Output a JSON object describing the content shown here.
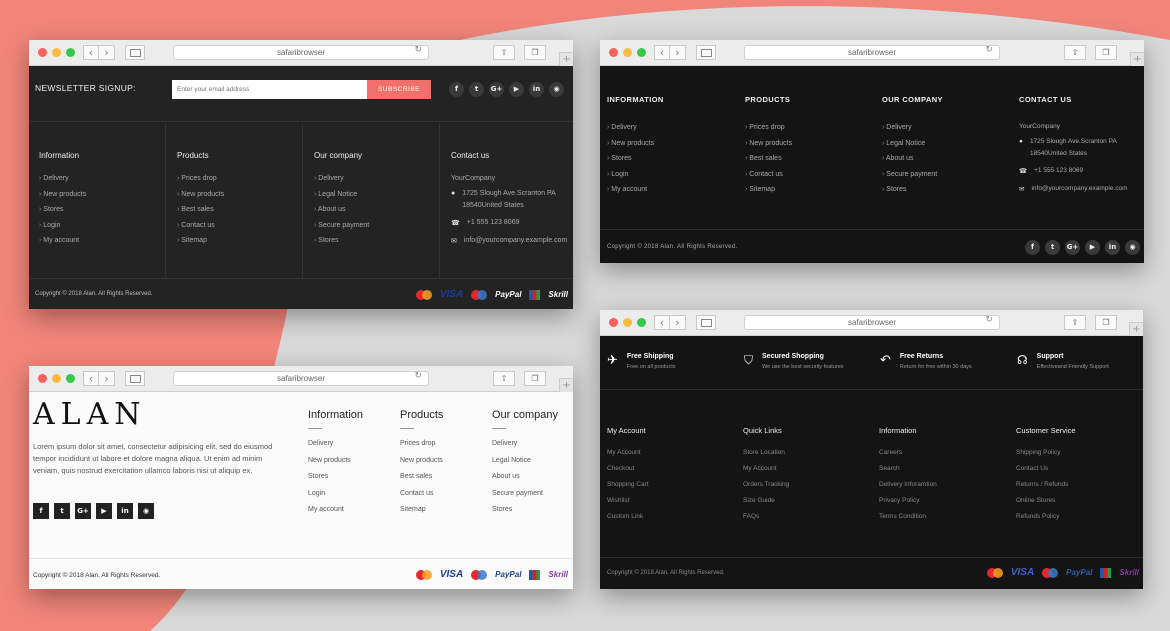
{
  "browser": {
    "url_text": "safaribrowser",
    "back": "‹",
    "forward": "›",
    "reload": "↻",
    "share": "⇧",
    "tabs": "❐",
    "new_tab": "+"
  },
  "colors": {
    "accent": "#f2706b",
    "background_shape": "#f2857a",
    "dark": "#232323",
    "darker": "#141414"
  },
  "w1": {
    "newsletter_label": "NEWSLETTER SIGNUP:",
    "email_placeholder": "Enter your email address",
    "subscribe": "SUBSCRIBE",
    "social": [
      "f",
      "t",
      "G+",
      "▶",
      "in",
      "◉"
    ],
    "cols": [
      {
        "title": "Information",
        "items": [
          "Delivery",
          "New products",
          "Stores",
          "Login",
          "My account"
        ]
      },
      {
        "title": "Products",
        "items": [
          "Prices drop",
          "New products",
          "Best sales",
          "Contact us",
          "Sitemap"
        ]
      },
      {
        "title": "Our company",
        "items": [
          "Delivery",
          "Legal Notice",
          "About us",
          "Secure payment",
          "Stores"
        ]
      }
    ],
    "contact": {
      "title": "Contact us",
      "company": "YourCompany",
      "address1": "1725 Slough Ave.Scranton PA",
      "address2": "18540United States",
      "phone": "+1 555 123 8069",
      "email": "info@yourcompany.example.com"
    },
    "copyright": "Copyright © 2018 Alan. All Rights Reserved.",
    "payments": {
      "visa": "VISA",
      "paypal": "PayPal",
      "skrill": "Skrill"
    }
  },
  "w2": {
    "cols": [
      {
        "title": "INFORMATION",
        "items": [
          "Delivery",
          "New products",
          "Stores",
          "Login",
          "My account"
        ]
      },
      {
        "title": "PRODUCTS",
        "items": [
          "Prices drop",
          "New products",
          "Best sales",
          "Contact us",
          "Sitemap"
        ]
      },
      {
        "title": "OUR COMPANY",
        "items": [
          "Delivery",
          "Legal Notice",
          "About us",
          "Secure payment",
          "Stores"
        ]
      }
    ],
    "contact": {
      "title": "CONTACT US",
      "company": "YourCompany",
      "address1": "1725 Slough Ave.Scranton PA",
      "address2": "18540United States",
      "phone": "+1 555 123 8069",
      "email": "info@yourcompany.example.com"
    },
    "copyright": "Copyright © 2018 Alan. All Rights Reserved.",
    "social": [
      "f",
      "t",
      "G+",
      "▶",
      "in",
      "◉"
    ]
  },
  "w3": {
    "logo": "ALAN",
    "description": "Lorem ipsum dolor sit amet, consectetur adipisicing elit, sed do eiusmod tempor incididunt ut labore et dolore magna aliqua. Ut enim ad minim veniam, quis nostrud exercitation ullamco laboris nisi ut aliquip ex.",
    "social": [
      "f",
      "t",
      "G+",
      "▶",
      "in",
      "◉"
    ],
    "cols": [
      {
        "title": "Information",
        "items": [
          "Delivery",
          "New products",
          "Stores",
          "Login",
          "My account"
        ]
      },
      {
        "title": "Products",
        "items": [
          "Prices drop",
          "New products",
          "Best sales",
          "Contact us",
          "Sitemap"
        ]
      },
      {
        "title": "Our company",
        "items": [
          "Delivery",
          "Legal Notice",
          "About us",
          "Secure payment",
          "Stores"
        ]
      }
    ],
    "copyright": "Copyright © 2018 Alan. All Rights Reserved.",
    "payments": {
      "visa": "VISA",
      "paypal": "PayPal",
      "skrill": "Skrill"
    }
  },
  "w4": {
    "features": [
      {
        "title": "Free Shipping",
        "sub": "Free on all products",
        "icon": "airplane-icon"
      },
      {
        "title": "Secured Shopping",
        "sub": "We use the best security features",
        "icon": "shield-icon"
      },
      {
        "title": "Free Returns",
        "sub": "Return for free within 30 days",
        "icon": "return-arrow-icon"
      },
      {
        "title": "Support",
        "sub": "Effectiveand Friendly Support",
        "icon": "headset-icon"
      }
    ],
    "cols": [
      {
        "title": "My Account",
        "items": [
          "My Account",
          "Checkout",
          "Shopping Cart",
          "Wishlist",
          "Custom Link"
        ]
      },
      {
        "title": "Quick Links",
        "items": [
          "Store Location",
          "My Account",
          "Orders Tracking",
          "Size Guide",
          "FAQs"
        ]
      },
      {
        "title": "Information",
        "items": [
          "Careers",
          "Search",
          "Delivery Inforamtion",
          "Privacy Policy",
          "Terms Condition"
        ]
      },
      {
        "title": "Customer Service",
        "items": [
          "Shipping Policy",
          "Contact Us",
          "Returns / Refunds",
          "Online Stores",
          "Refunds Policy"
        ]
      }
    ],
    "copyright": "Copyright © 2018 Alan. All Rights Reserved.",
    "payments": {
      "visa": "VISA",
      "paypal": "PayPal",
      "skrill": "Skrill"
    }
  }
}
